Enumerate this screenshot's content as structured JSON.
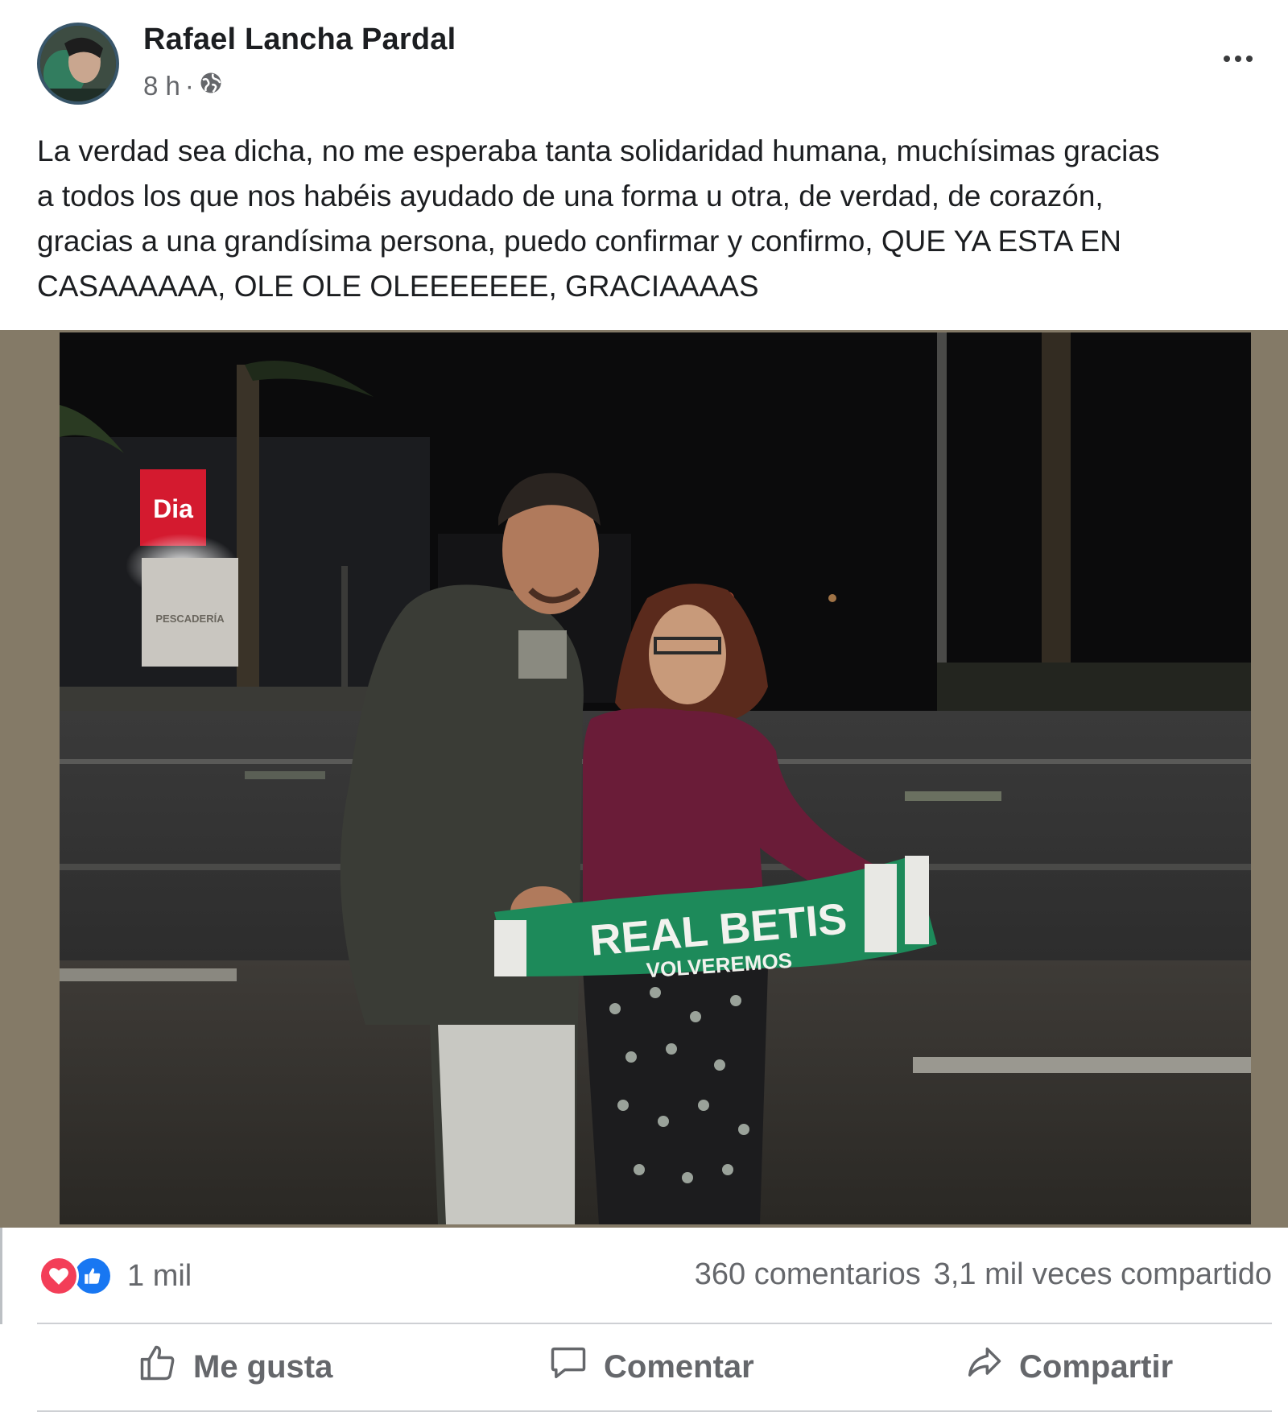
{
  "post": {
    "author": "Rafael Lancha Pardal",
    "time": "8 h",
    "separator": "·",
    "privacy_icon": "globe-icon",
    "more_icon": "more-options-icon",
    "text": "La verdad sea dicha, no me esperaba tanta solidaridad humana, muchísimas gracias\na todos los que nos habéis ayudado de una forma u otra, de verdad, de corazón,\ngracias a una grandísima persona, puedo confirmar y confirmo, QUE YA ESTA EN\nCASAAAAAA, OLE OLE OLEEEEEEE, GRACIAAAAS",
    "photo": {
      "store_sign": "Dia",
      "store_sub_sign": "PESCADERÍA",
      "scarf_text": "REAL BETIS",
      "scarf_subtext": "VOLVEREMOS"
    }
  },
  "stats": {
    "reactions": [
      "heart-reaction-icon",
      "like-reaction-icon"
    ],
    "reaction_count": "1 mil",
    "comments": "360 comentarios",
    "shares": "3,1 mil veces compartido"
  },
  "actions": {
    "like": "Me gusta",
    "comment": "Comentar",
    "share": "Compartir"
  },
  "colors": {
    "text_primary": "#1c1e21",
    "text_secondary": "#65676b",
    "like_blue": "#1877f2",
    "love_red": "#f33e58",
    "photo_border": "#847a67"
  }
}
